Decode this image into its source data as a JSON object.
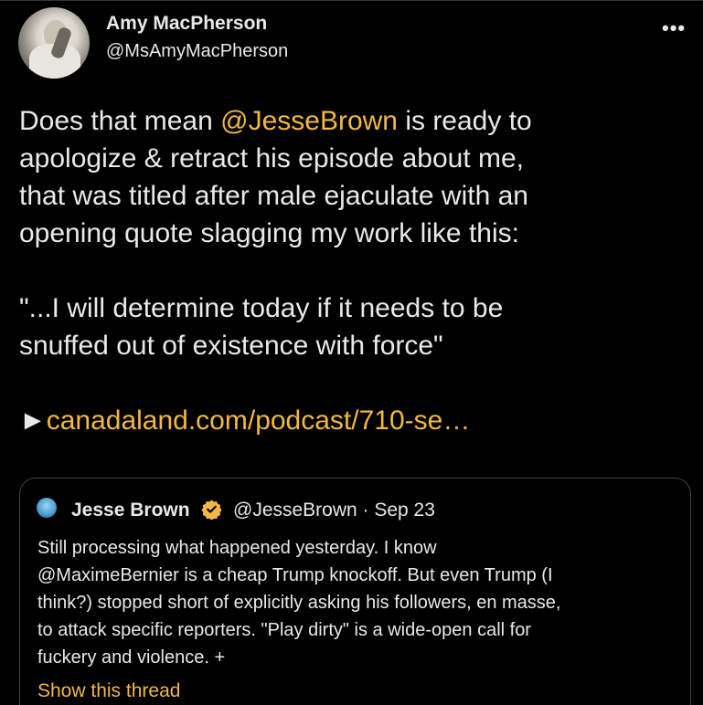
{
  "colors": {
    "background": "#000000",
    "text": "#e7e9ea",
    "accent": "#f2b843",
    "border": "#3e4144",
    "verified": "#f2b843"
  },
  "tweet": {
    "author": {
      "display_name": "Amy MacPherson",
      "handle": "@MsAmyMacPherson",
      "avatar": "avatar"
    },
    "more_icon": "more-icon",
    "more_glyph": "•••",
    "body": {
      "line1_pre": "Does that mean ",
      "line1_mention": "@JesseBrown",
      "line1_post": " is ready to",
      "line2": "apologize & retract his episode about me,",
      "line3": "that was titled after male ejaculate with an",
      "line4": "opening quote slagging my work like this:",
      "line5": "\"...I will determine today if it needs to be",
      "line6": "snuffed out of existence with force\"",
      "arrow": "►",
      "link": "canadaland.com/podcast/710-se…"
    }
  },
  "quote": {
    "author": {
      "display_name": "Jesse Brown",
      "verified_icon": "verified-badge-icon",
      "handle_date": "@JesseBrown · Sep 23"
    },
    "lines": [
      "Still processing what happened yesterday. I know",
      "@MaximeBernier is a cheap Trump knockoff. But even Trump (I",
      "think?) stopped short of explicitly asking his followers, en masse,",
      "to attack specific reporters. \"Play dirty\" is a wide-open call for",
      "fuckery and violence. +"
    ],
    "show_thread": "Show this thread"
  }
}
